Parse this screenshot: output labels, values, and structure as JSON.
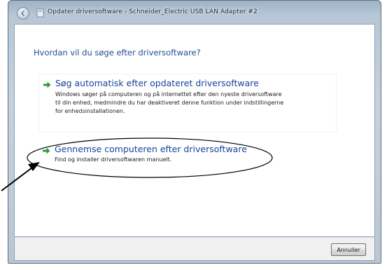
{
  "window": {
    "title": "Opdater driversoftware - Schneider_Electric USB LAN Adapter #2"
  },
  "dialog": {
    "question": "Hvordan vil du søge efter driversoftware?",
    "options": [
      {
        "title": "Søg automatisk efter opdateret driversoftware",
        "description_lines": [
          "Windows søger på computeren og på internettet efter den nyeste driversoftware",
          "til din enhed, medmindre du har deaktiveret denne funktion under indstillingerne",
          "for enhedsinstallationen."
        ]
      },
      {
        "title": "Gennemse computeren efter driversoftware",
        "description_lines": [
          "Find og installer driversoftwaren manuelt."
        ]
      }
    ]
  },
  "footer": {
    "cancel_label": "Annuller"
  },
  "icons": {
    "back": "back-arrow-icon",
    "title": "device-icon",
    "option_arrow": "green-arrow-icon"
  },
  "colors": {
    "question_text": "#1f4f8e",
    "option_title": "#15449b",
    "option_arrow": "#2e9a3a",
    "annotation": "#000000"
  }
}
